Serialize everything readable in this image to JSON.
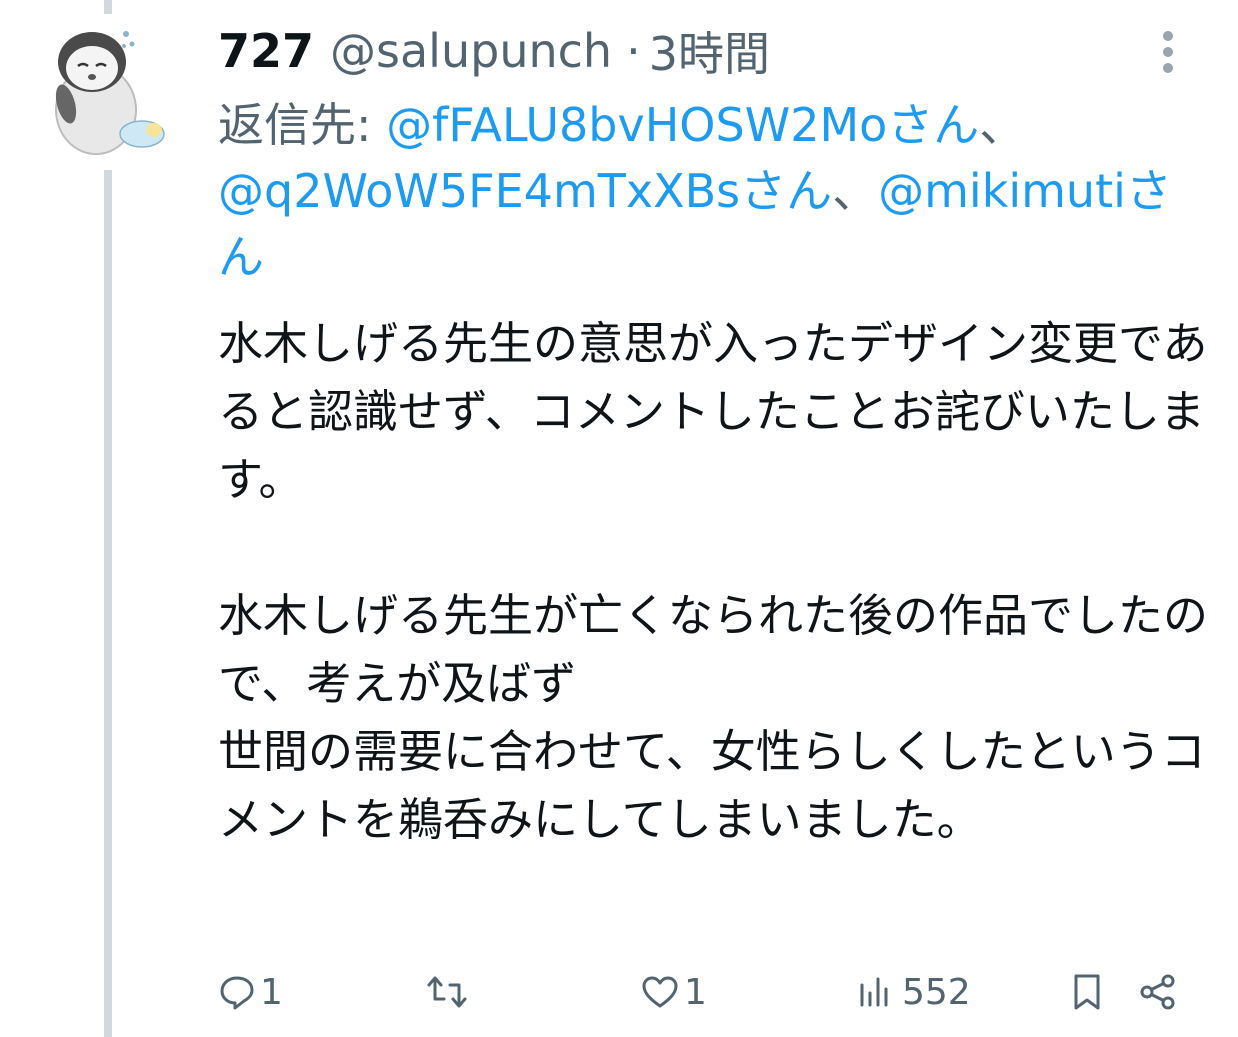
{
  "tweet": {
    "display_name": "727",
    "handle": "@salupunch",
    "separator": "·",
    "time": "3時間",
    "reply_prefix": "返信先: ",
    "mentions": [
      {
        "text": "@fFALU8bvHOSW2Moさん"
      },
      {
        "text": "@q2WoW5FE4mTxXBsさん"
      },
      {
        "text": "@mikimutiさん"
      }
    ],
    "mention_separator": "、",
    "body": "水木しげる先生の意思が入ったデザイン変更であると認識せず、コメントしたことお詫びいたします。\n\n水木しげる先生が亡くなられた後の作品でしたので、考えが及ばず\n世間の需要に合わせて、女性らしくしたというコメントを鵜呑みにしてしまいました。"
  },
  "actions": {
    "reply_count": "1",
    "retweet_count": "",
    "like_count": "1",
    "views_count": "552"
  },
  "icons": {
    "more": "more-vertical-icon",
    "reply": "reply-icon",
    "retweet": "retweet-icon",
    "like": "heart-icon",
    "views": "views-icon",
    "bookmark": "bookmark-icon",
    "share": "share-icon"
  },
  "colors": {
    "link": "#1d9bf0",
    "secondary": "#536471",
    "primary_text": "#0f1419",
    "thread_line": "#cfd9de"
  }
}
